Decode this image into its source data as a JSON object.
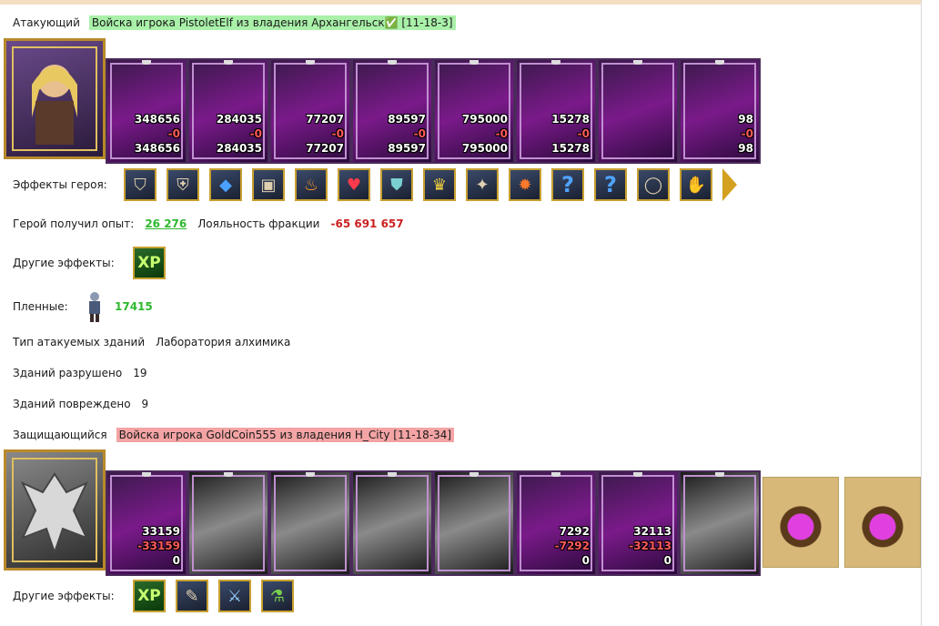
{
  "attacker": {
    "label": "Атакующий",
    "army": "Войска игрока PistoletElf из владения Архангельск✅ [11-18-3]",
    "units": [
      {
        "name": "unit-1",
        "c1": "348656",
        "c2": "-0",
        "c3": "348656"
      },
      {
        "name": "unit-2",
        "c1": "284035",
        "c2": "-0",
        "c3": "284035"
      },
      {
        "name": "unit-3",
        "c1": "77207",
        "c2": "-0",
        "c3": "77207"
      },
      {
        "name": "unit-4",
        "c1": "89597",
        "c2": "-0",
        "c3": "89597"
      },
      {
        "name": "unit-5",
        "c1": "795000",
        "c2": "-0",
        "c3": "795000"
      },
      {
        "name": "unit-6",
        "c1": "15278",
        "c2": "-0",
        "c3": "15278"
      },
      {
        "name": "unit-7",
        "c1": "",
        "c2": "",
        "c3": ""
      },
      {
        "name": "unit-8",
        "c1": "98",
        "c2": "-0",
        "c3": "98"
      }
    ]
  },
  "hero_effects": {
    "label": "Эффекты героя:",
    "icons": [
      "shield-gold-icon",
      "armor-icon",
      "crystal-icon",
      "chest-icon",
      "fire-chest-icon",
      "heart-icon",
      "shield-icon",
      "crown-icon",
      "pendant-icon",
      "fire-gem-icon",
      "question-icon",
      "question-icon",
      "ring-icon",
      "gloves-icon"
    ]
  },
  "hero_stats": {
    "exp_label": "Герой получил опыт:",
    "exp_value": "26 276",
    "loyalty_label": "Лояльность фракции",
    "loyalty_value": "-65 691 657"
  },
  "other_effects_1": {
    "label": "Другие эффекты:",
    "xp": "XP"
  },
  "prisoners": {
    "label": "Пленные:",
    "value": "17415"
  },
  "building_type": {
    "label": "Тип атакуемых зданий",
    "value": "Лаборатория алхимика"
  },
  "destroyed": {
    "label": "Зданий разрушено",
    "value": "19"
  },
  "damaged": {
    "label": "Зданий повреждено",
    "value": "9"
  },
  "defender": {
    "label": "Защищающийся",
    "army": "Войска игрока GoldCoin555 из владения H_City [11-18-34]",
    "units": [
      {
        "name": "unit-1",
        "style": "purple",
        "c1": "33159",
        "c2": "-33159",
        "c3": "0"
      },
      {
        "name": "unit-2",
        "style": "gray",
        "c1": "",
        "c2": "",
        "c3": ""
      },
      {
        "name": "unit-3",
        "style": "gray",
        "c1": "",
        "c2": "",
        "c3": ""
      },
      {
        "name": "unit-4",
        "style": "gray",
        "c1": "",
        "c2": "",
        "c3": ""
      },
      {
        "name": "unit-5",
        "style": "gray",
        "c1": "",
        "c2": "",
        "c3": ""
      },
      {
        "name": "unit-6",
        "style": "purple",
        "c1": "7292",
        "c2": "-7292",
        "c3": "0"
      },
      {
        "name": "unit-7",
        "style": "purple",
        "c1": "32113",
        "c2": "-32113",
        "c3": "0"
      },
      {
        "name": "unit-8",
        "style": "gray",
        "c1": "",
        "c2": "",
        "c3": ""
      }
    ]
  },
  "other_effects_2": {
    "label": "Другие эффекты:",
    "xp": "XP",
    "icons": [
      "sword-book-icon",
      "sword-icon",
      "potion-icon"
    ]
  }
}
